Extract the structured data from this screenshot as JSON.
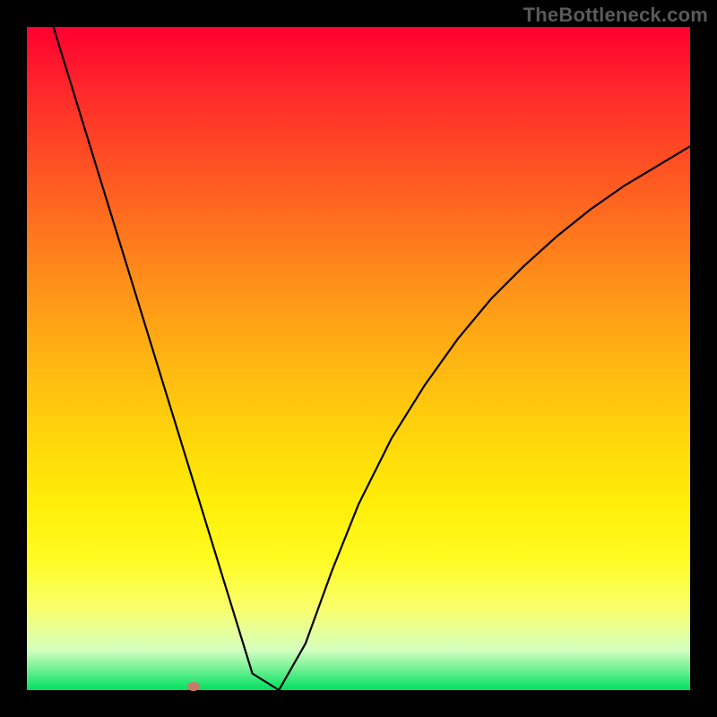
{
  "watermark": "TheBottleneck.com",
  "chart_data": {
    "type": "line",
    "title": "",
    "xlabel": "",
    "ylabel": "",
    "xlim": [
      0,
      100
    ],
    "ylim": [
      0,
      100
    ],
    "grid": false,
    "legend": false,
    "background": "rainbow-gradient (red top to green bottom)",
    "series": [
      {
        "name": "bottleneck-curve",
        "x": [
          4,
          6,
          8,
          10,
          12,
          14,
          16,
          18,
          20,
          22,
          24,
          26,
          28,
          30,
          34,
          38,
          42,
          46,
          50,
          55,
          60,
          65,
          70,
          75,
          80,
          85,
          90,
          95,
          100
        ],
        "values": [
          100,
          93.5,
          87,
          80.5,
          74,
          67.5,
          61,
          54.5,
          48,
          41.5,
          35,
          28.5,
          22,
          15.5,
          2.5,
          0,
          7,
          18,
          28,
          38,
          46,
          53,
          59,
          64,
          68.5,
          72.5,
          76,
          79,
          82
        ]
      }
    ],
    "marker": {
      "x_pct": 25.2,
      "y_pct": 0.5,
      "color": "#c77a6b"
    },
    "frame": {
      "border_color": "#000000",
      "border_width_px": 30
    }
  }
}
